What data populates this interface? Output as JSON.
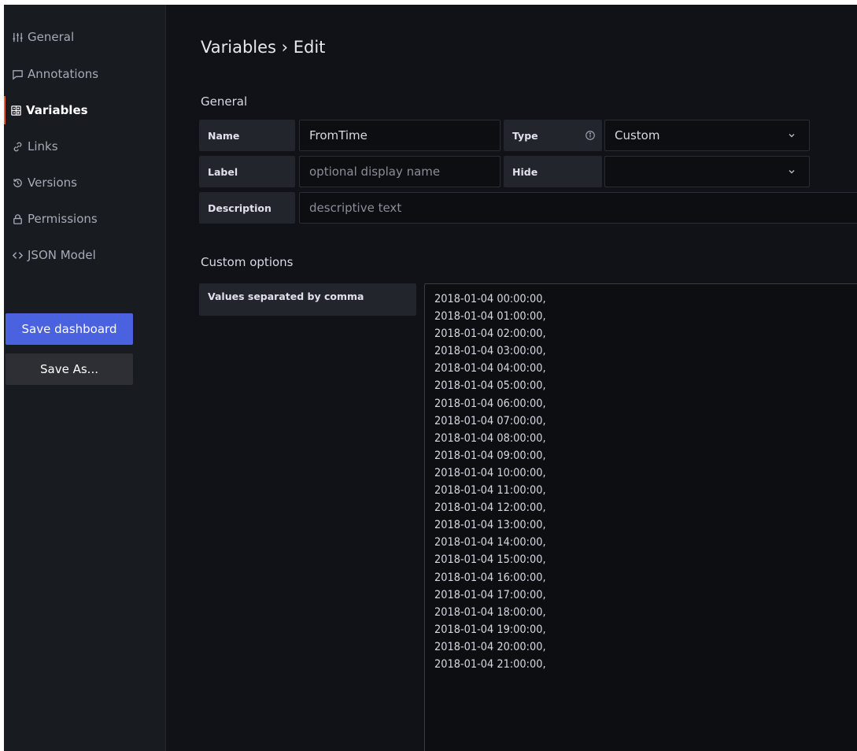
{
  "sidebar": {
    "items": [
      {
        "label": "General",
        "icon": "sliders-icon"
      },
      {
        "label": "Annotations",
        "icon": "comment-icon"
      },
      {
        "label": "Variables",
        "icon": "calculator-icon",
        "active": true
      },
      {
        "label": "Links",
        "icon": "link-icon"
      },
      {
        "label": "Versions",
        "icon": "history-icon"
      },
      {
        "label": "Permissions",
        "icon": "lock-icon"
      },
      {
        "label": "JSON Model",
        "icon": "code-brackets-icon"
      }
    ],
    "save_label": "Save dashboard",
    "save_as_label": "Save As..."
  },
  "main": {
    "title": "Variables › Edit",
    "general": {
      "section_title": "General",
      "name_label": "Name",
      "name_value": "FromTime",
      "type_label": "Type",
      "type_value": "Custom",
      "label_label": "Label",
      "label_placeholder": "optional display name",
      "hide_label": "Hide",
      "hide_value": "",
      "description_label": "Description",
      "description_placeholder": "descriptive text"
    },
    "custom": {
      "section_title": "Custom options",
      "values_label": "Values separated by comma",
      "values": [
        "2018-01-04 00:00:00,",
        "2018-01-04 01:00:00,",
        "2018-01-04 02:00:00,",
        "2018-01-04 03:00:00,",
        "2018-01-04 04:00:00,",
        "2018-01-04 05:00:00,",
        "2018-01-04 06:00:00,",
        "2018-01-04 07:00:00,",
        "2018-01-04 08:00:00,",
        "2018-01-04 09:00:00,",
        "2018-01-04 10:00:00,",
        "2018-01-04 11:00:00,",
        "2018-01-04 12:00:00,",
        "2018-01-04 13:00:00,",
        "2018-01-04 14:00:00,",
        "2018-01-04 15:00:00,",
        "2018-01-04 16:00:00,",
        "2018-01-04 17:00:00,",
        "2018-01-04 18:00:00,",
        "2018-01-04 19:00:00,",
        "2018-01-04 20:00:00,",
        "2018-01-04 21:00:00,"
      ]
    }
  },
  "colors": {
    "primary": "#4a62e0",
    "active_indicator": "#f05a28",
    "background": "#111217"
  }
}
